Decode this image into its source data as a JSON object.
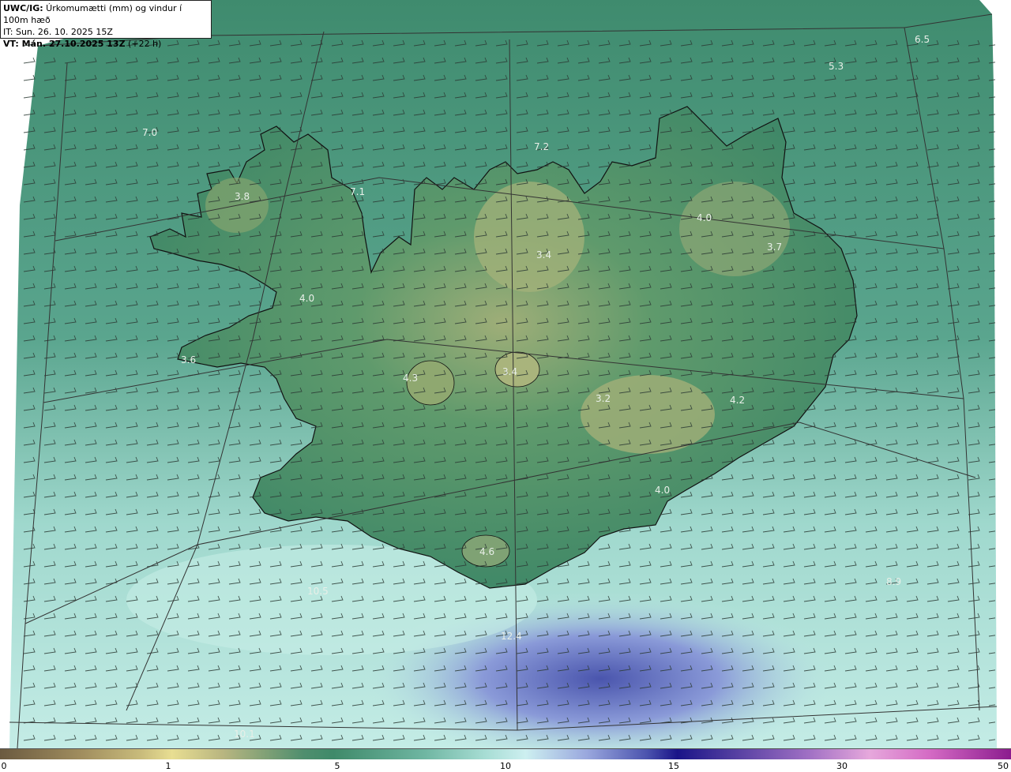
{
  "header": {
    "line1_bold": "UWC/IG:",
    "line1_rest": " Úrkomumætti (mm) og vindur í 100m hæð",
    "line2": "IT: Sun. 26. 10. 2025 15Z",
    "line3_bold": "VT: Mán. 27.10.2025 13Z",
    "line3_rest": " (+22 h)"
  },
  "colors": {
    "land_dark": "#3f8a6a",
    "land_high": "#a8b57a",
    "sea": "#58a38a",
    "sea_light": "#b8e6df",
    "precip_heavy": "#5a66b8",
    "coast": "#111111",
    "grid_line": "#333333"
  },
  "contour_labels": [
    {
      "text": "6.5"
    },
    {
      "text": "5.3"
    },
    {
      "text": "7.0"
    },
    {
      "text": "7.2"
    },
    {
      "text": "3.8"
    },
    {
      "text": "7.1"
    },
    {
      "text": "4.0"
    },
    {
      "text": "3.7"
    },
    {
      "text": "3.4"
    },
    {
      "text": "4.0"
    },
    {
      "text": "3.6"
    },
    {
      "text": "4.3"
    },
    {
      "text": "3.4"
    },
    {
      "text": "3.2"
    },
    {
      "text": "4.2"
    },
    {
      "text": "4.0"
    },
    {
      "text": "4.6"
    },
    {
      "text": "10.5"
    },
    {
      "text": "12.4"
    },
    {
      "text": "10.1"
    },
    {
      "text": "8.9"
    }
  ],
  "colorbar": {
    "ticks": [
      "0",
      "1",
      "5",
      "10",
      "15",
      "30",
      "50"
    ]
  }
}
